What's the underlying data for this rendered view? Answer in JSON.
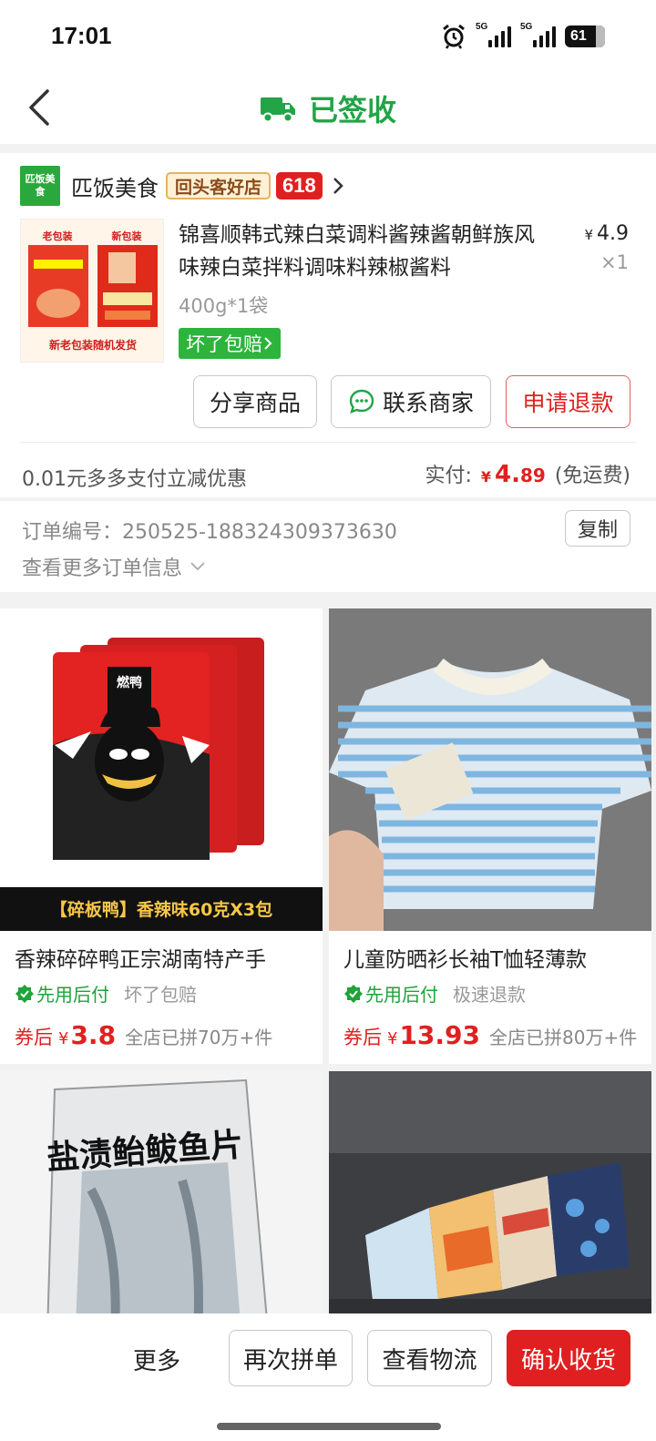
{
  "status_bar": {
    "time": "17:01",
    "network1": "5G",
    "network2": "5G",
    "battery": "61"
  },
  "header": {
    "title": "已签收"
  },
  "shop": {
    "logo_text": "匹饭美食",
    "name": "匹饭美食",
    "tag": "回头客好店",
    "promo": "618"
  },
  "product": {
    "image_text_old": "老包装",
    "image_text_new": "新包装",
    "image_caption": "新老包装随机发货",
    "title": "锦喜顺韩式辣白菜调料酱辣酱朝鲜族风味辣白菜拌料调味料辣椒酱料",
    "currency": "¥",
    "price": "4.9",
    "qty": "×1",
    "spec": "400g*1袋",
    "badge": "坏了包赔"
  },
  "actions": {
    "share": "分享商品",
    "contact": "联系商家",
    "refund": "申请退款"
  },
  "payment": {
    "discount": "0.01元多多支付立减优惠",
    "paid_label": "实付:",
    "currency": "¥",
    "paid_int": "4.",
    "paid_dec": "89",
    "shipping": "(免运费)"
  },
  "order_info": {
    "order_no": "订单编号：250525-188324309373630",
    "copy": "复制",
    "more": "查看更多订单信息"
  },
  "recommendations": [
    {
      "name": "香辣碎碎鸭正宗湖南特产手",
      "banner": "【碎板鸭】香辣味60克X3包",
      "brand": "燃鸭",
      "pay_tag": "先用后付",
      "extra_tag": "坏了包赔",
      "after_label": "券后",
      "currency": "¥",
      "price": "3.8",
      "sold": "全店已拼70万+件"
    },
    {
      "name": "儿童防晒衫长袖T恤轻薄款",
      "pay_tag": "先用后付",
      "extra_tag": "极速退款",
      "after_label": "券后",
      "currency": "¥",
      "price": "13.93",
      "sold": "全店已拼80万+件"
    },
    {
      "image_text": "盐渍鲐鲅鱼片"
    },
    {}
  ],
  "bottom_bar": {
    "more": "更多",
    "reorder": "再次拼单",
    "logistics": "查看物流",
    "confirm": "确认收货"
  },
  "colors": {
    "brand_green": "#22a447",
    "price_red": "#e02020",
    "tag_green": "#2cb43c"
  }
}
